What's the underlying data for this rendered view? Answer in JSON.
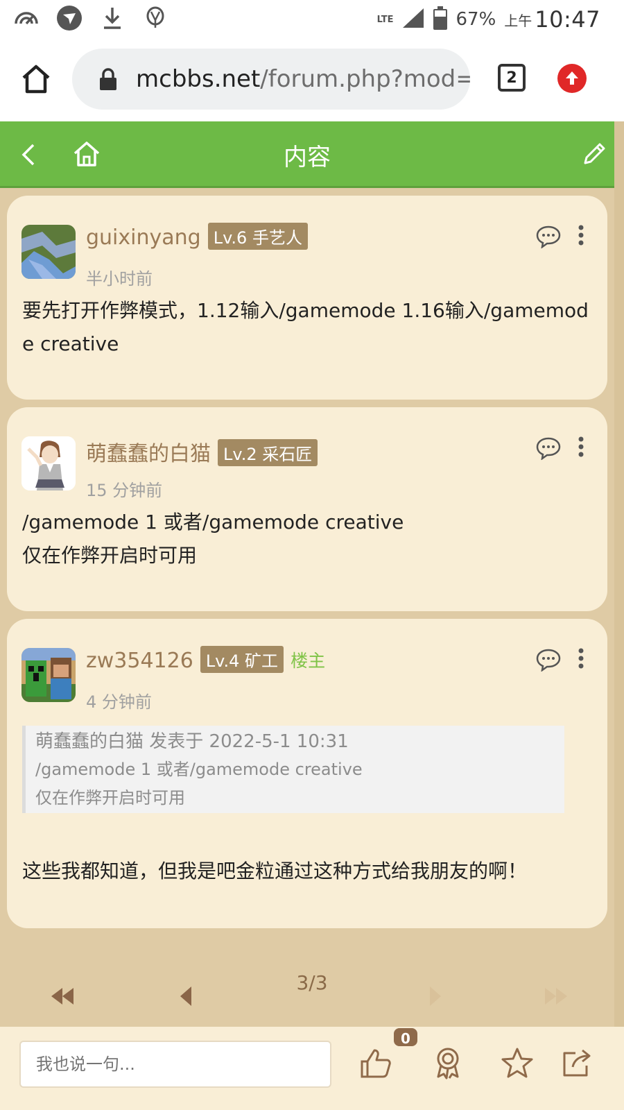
{
  "status_bar": {
    "network": "LTE",
    "battery_percent": "67%",
    "ampm": "上午",
    "time": "10:47",
    "battery_level": 0.67
  },
  "browser": {
    "url_host": "mcbbs.net",
    "url_path": "/forum.php?mod=vi",
    "tab_count": "2"
  },
  "header": {
    "title": "内容"
  },
  "posts": [
    {
      "username": "guixinyang",
      "level": "Lv.6 手艺人",
      "time": "半小时前",
      "content": "要先打开作弊模式，1.12输入/gamemode 1.16输入/gamemode creative"
    },
    {
      "username": "萌蠢蠢的白猫",
      "level": "Lv.2 采石匠",
      "time": "15 分钟前",
      "content_line1": "/gamemode 1 或者/gamemode creative",
      "content_line2": "仅在作弊开启时可用"
    },
    {
      "username": "zw354126",
      "level": "Lv.4 矿工",
      "op_badge": "楼主",
      "time": "4 分钟前",
      "quote": {
        "header": "萌蠢蠢的白猫 发表于 2022-5-1 10:31",
        "line1": "/gamemode 1 或者/gamemode creative",
        "line2": "仅在作弊开启时可用"
      },
      "content": "这些我都知道，但我是吧金粒通过这种方式给我朋友的啊！"
    }
  ],
  "pager": {
    "label": "3/3"
  },
  "bottom_bar": {
    "input_placeholder": "我也说一句...",
    "like_count": "0"
  },
  "colors": {
    "header_green": "#6dba46",
    "card_bg": "#f9eed6",
    "page_bg": "#dfcba5",
    "username": "#9a7a56",
    "level_badge": "#a38a62",
    "op_green": "#7fc346",
    "update_red": "#e02828"
  }
}
